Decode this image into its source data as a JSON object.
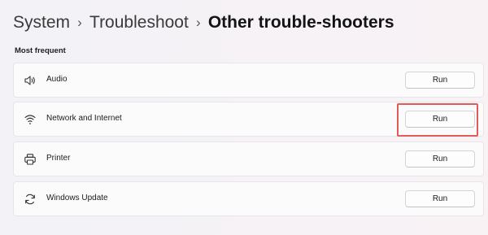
{
  "breadcrumb": {
    "items": [
      "System",
      "Troubleshoot"
    ],
    "current": "Other trouble-shooters",
    "separator": "›"
  },
  "section": {
    "title": "Most frequent"
  },
  "troubleshooters": [
    {
      "label": "Audio",
      "icon": "speaker-icon",
      "button": "Run"
    },
    {
      "label": "Network and Internet",
      "icon": "wifi-icon",
      "button": "Run"
    },
    {
      "label": "Printer",
      "icon": "printer-icon",
      "button": "Run"
    },
    {
      "label": "Windows Update",
      "icon": "sync-icon",
      "button": "Run"
    }
  ],
  "colors": {
    "highlight_border": "#e25b5b",
    "card_background": "#fbfbfc"
  }
}
